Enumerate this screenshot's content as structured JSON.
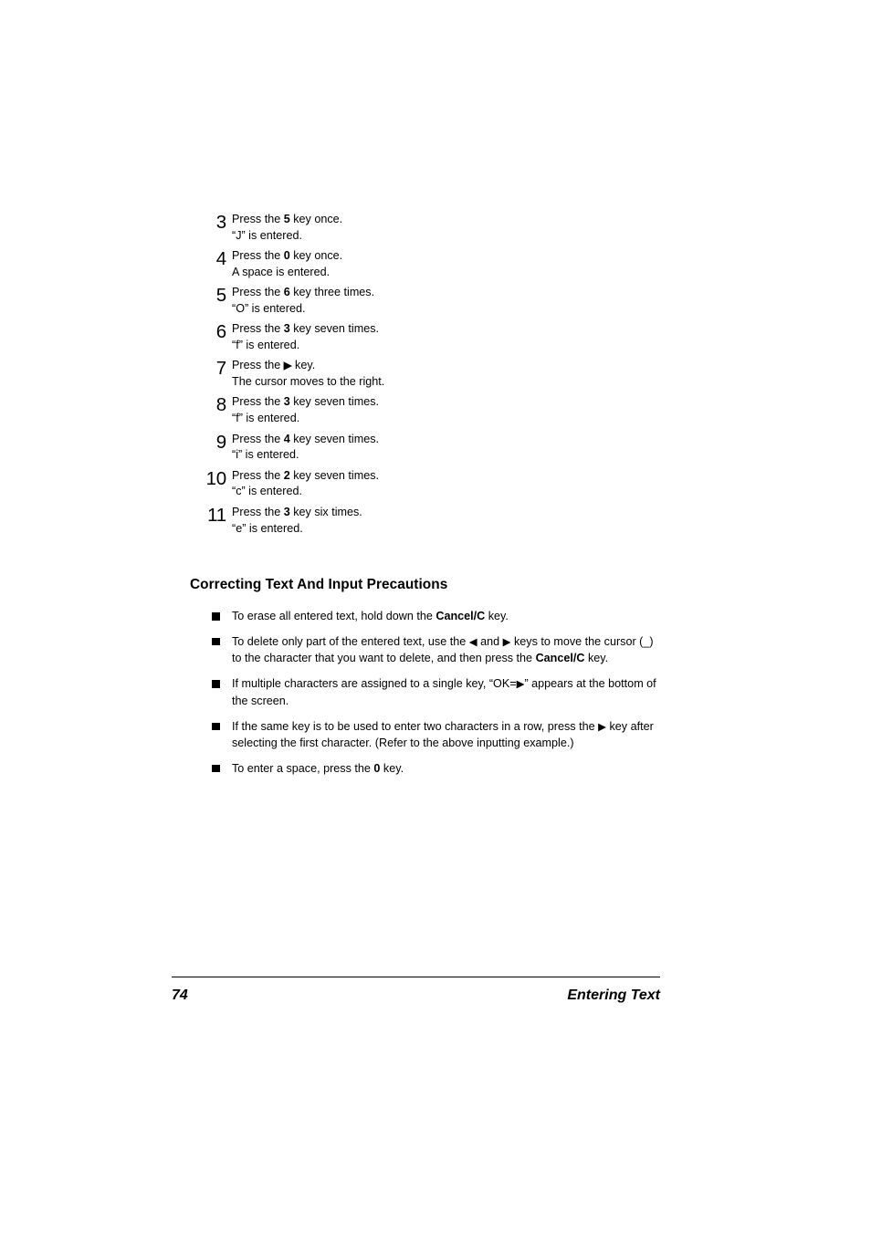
{
  "document": {
    "steps": [
      {
        "number": "3",
        "instruction_prefix": "Press the ",
        "key": "5",
        "instruction_suffix": " key once.",
        "result": "“J” is entered."
      },
      {
        "number": "4",
        "instruction_prefix": "Press the ",
        "key": "0",
        "instruction_suffix": " key once.",
        "result": "A space is entered."
      },
      {
        "number": "5",
        "instruction_prefix": "Press the ",
        "key": "6",
        "instruction_suffix": " key three times.",
        "result": "“O” is entered."
      },
      {
        "number": "6",
        "instruction_prefix": "Press the ",
        "key": "3",
        "instruction_suffix": " key seven times.",
        "result": "“f” is entered."
      },
      {
        "number": "7",
        "instruction_prefix": "Press the ",
        "key": "▶",
        "instruction_suffix": " key.",
        "result": "The cursor moves to the right."
      },
      {
        "number": "8",
        "instruction_prefix": "Press the ",
        "key": "3",
        "instruction_suffix": " key seven times.",
        "result": "“f” is entered."
      },
      {
        "number": "9",
        "instruction_prefix": "Press the ",
        "key": "4",
        "instruction_suffix": " key seven times.",
        "result": "“i” is entered."
      },
      {
        "number": "10",
        "instruction_prefix": "Press the ",
        "key": "2",
        "instruction_suffix": " key seven times.",
        "result": "“c” is entered."
      },
      {
        "number": "11",
        "instruction_prefix": "Press the ",
        "key": "3",
        "instruction_suffix": " key six times.",
        "result": "“e” is entered."
      }
    ],
    "section": {
      "heading": "Correcting Text And Input Precautions",
      "bullets": [
        {
          "parts": [
            {
              "text": "To erase all entered text, hold down the ",
              "bold": false
            },
            {
              "text": "Cancel/C",
              "bold": true
            },
            {
              "text": " key.",
              "bold": false
            }
          ]
        },
        {
          "parts": [
            {
              "text": "To delete only part of the entered text, use the ",
              "bold": false
            },
            {
              "text": "◀",
              "bold": false
            },
            {
              "text": " and ",
              "bold": false
            },
            {
              "text": "▶",
              "bold": false
            },
            {
              "text": " keys to move the cursor (_) to the character that you want to delete, and then press the ",
              "bold": false
            },
            {
              "text": "Cancel/C",
              "bold": true
            },
            {
              "text": " key.",
              "bold": false
            }
          ]
        },
        {
          "parts": [
            {
              "text": "If multiple characters are assigned to a single key, “OK=",
              "bold": false
            },
            {
              "text": "▶",
              "bold": false
            },
            {
              "text": "” appears at the bottom of the screen.",
              "bold": false
            }
          ]
        },
        {
          "parts": [
            {
              "text": "If the same key is to be used to enter two characters in a row, press the ",
              "bold": false
            },
            {
              "text": "▶",
              "bold": false
            },
            {
              "text": " key after selecting the first character. (Refer to the above inputting exam­ple.)",
              "bold": false
            }
          ]
        },
        {
          "parts": [
            {
              "text": "To enter a space, press the ",
              "bold": false
            },
            {
              "text": "0",
              "bold": true
            },
            {
              "text": " key.",
              "bold": false
            }
          ]
        }
      ]
    },
    "footer": {
      "page_number": "74",
      "section_title": "Entering Text"
    }
  }
}
